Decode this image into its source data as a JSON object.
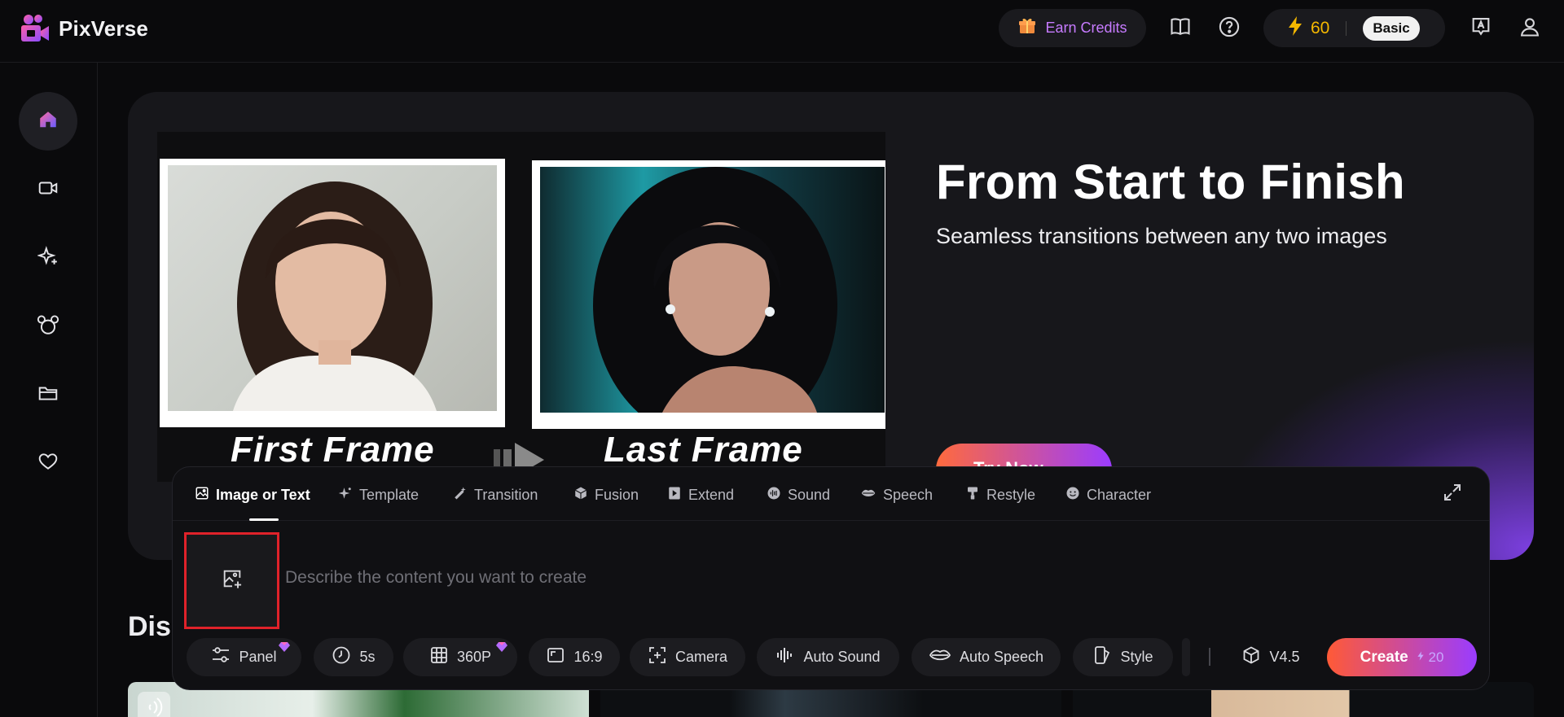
{
  "header": {
    "logo_text": "PixVerse",
    "earn_credits_label": "Earn Credits",
    "credits": "60",
    "plan": "Basic"
  },
  "sidebar": {
    "items": [
      {
        "name": "home",
        "icon": "home-icon",
        "active": true
      },
      {
        "name": "video",
        "icon": "video-camera-icon",
        "active": false
      },
      {
        "name": "effects",
        "icon": "sparkle-icon",
        "active": false
      },
      {
        "name": "characters",
        "icon": "mouse-head-icon",
        "active": false
      },
      {
        "name": "assets",
        "icon": "folder-icon",
        "active": false
      },
      {
        "name": "favorites",
        "icon": "heart-icon",
        "active": false
      }
    ]
  },
  "hero": {
    "title": "From Start to Finish",
    "subtitle": "Seamless transitions between any two images",
    "first_label": "First Frame",
    "last_label": "Last Frame",
    "cta_label": "Try Now"
  },
  "discover_label": "Dis",
  "composer": {
    "tabs": [
      {
        "label": "Image or Text",
        "icon": "image-icon",
        "active": true
      },
      {
        "label": "Template",
        "icon": "sparkle-icon"
      },
      {
        "label": "Transition",
        "icon": "magic-wand-icon"
      },
      {
        "label": "Fusion",
        "icon": "cube-icon"
      },
      {
        "label": "Extend",
        "icon": "play-square-icon"
      },
      {
        "label": "Sound",
        "icon": "sound-wave-icon"
      },
      {
        "label": "Speech",
        "icon": "lips-icon"
      },
      {
        "label": "Restyle",
        "icon": "paint-roller-icon"
      },
      {
        "label": "Character",
        "icon": "smiley-icon"
      }
    ],
    "prompt_placeholder": "Describe the content you want to create",
    "options": {
      "panel": "Panel",
      "duration": "5s",
      "resolution": "360P",
      "aspect": "16:9",
      "camera": "Camera",
      "auto_sound": "Auto Sound",
      "auto_speech": "Auto Speech",
      "style": "Style",
      "model": "V4.5"
    },
    "create_label": "Create",
    "create_cost": "20"
  },
  "colors": {
    "accent_orange": "#ff5a36",
    "accent_purple": "#9a3cff",
    "credits_yellow": "#f5b800",
    "earn_purple": "#c77bff",
    "highlight_red": "#e0222a"
  }
}
